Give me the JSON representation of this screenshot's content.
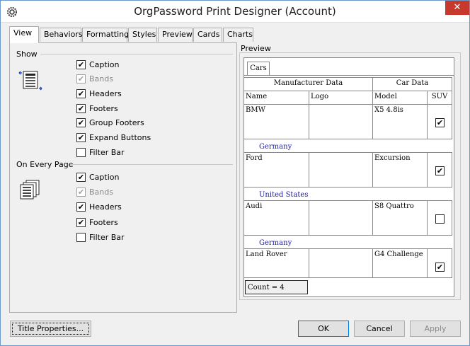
{
  "window": {
    "title": "OrgPassword Print Designer (Account)",
    "close_glyph": "✕"
  },
  "tabs": [
    {
      "label": "View",
      "active": true
    },
    {
      "label": "Behaviors"
    },
    {
      "label": "Formatting"
    },
    {
      "label": "Styles"
    },
    {
      "label": "Preview"
    },
    {
      "label": "Cards"
    },
    {
      "label": "Charts"
    }
  ],
  "show_group": {
    "label": "Show",
    "items": [
      {
        "label": "Caption",
        "checked": true,
        "disabled": false
      },
      {
        "label": "Bands",
        "checked": true,
        "disabled": true
      },
      {
        "label": "Headers",
        "checked": true,
        "disabled": false
      },
      {
        "label": "Footers",
        "checked": true,
        "disabled": false
      },
      {
        "label": "Group Footers",
        "checked": true,
        "disabled": false
      },
      {
        "label": "Expand Buttons",
        "checked": true,
        "disabled": false
      },
      {
        "label": "Filter Bar",
        "checked": false,
        "disabled": false
      }
    ]
  },
  "every_page_group": {
    "label": "On Every Page",
    "items": [
      {
        "label": "Caption",
        "checked": true,
        "disabled": false
      },
      {
        "label": "Bands",
        "checked": true,
        "disabled": true
      },
      {
        "label": "Headers",
        "checked": true,
        "disabled": false
      },
      {
        "label": "Footers",
        "checked": true,
        "disabled": false
      },
      {
        "label": "Filter Bar",
        "checked": false,
        "disabled": false
      }
    ]
  },
  "preview": {
    "label": "Preview",
    "tab": "Cars",
    "bands": [
      "Manufacturer Data",
      "Car Data"
    ],
    "columns": [
      "Name",
      "Logo",
      "Model",
      "SUV"
    ],
    "rows": [
      {
        "name": "BMW",
        "logo": "",
        "model": "X5 4.8is",
        "suv": true,
        "group": "Germany"
      },
      {
        "name": "Ford",
        "logo": "",
        "model": "Excursion",
        "suv": true,
        "group": "United States"
      },
      {
        "name": "Audi",
        "logo": "",
        "model": "S8 Quattro",
        "suv": false,
        "group": "Germany"
      },
      {
        "name": "Land Rover",
        "logo": "",
        "model": "G4 Challenge",
        "suv": true,
        "group": ""
      }
    ],
    "footer": "Count = 4"
  },
  "buttons": {
    "title_properties": "Title Properties...",
    "ok": "OK",
    "cancel": "Cancel",
    "apply": "Apply"
  },
  "check_glyph": "✔"
}
